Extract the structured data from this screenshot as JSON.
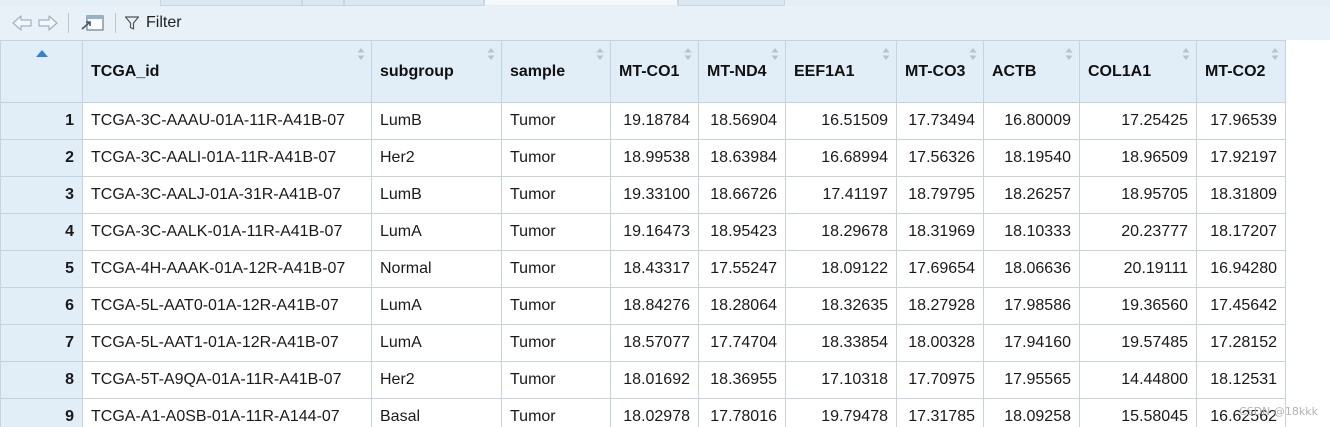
{
  "toolbar": {
    "back_icon": "arrow-left-icon",
    "forward_icon": "arrow-right-icon",
    "popout_icon": "open-in-window-icon",
    "filter_icon": "funnel-icon",
    "filter_label": "Filter"
  },
  "table": {
    "columns": [
      "TCGA_id",
      "subgroup",
      "sample",
      "MT-CO1",
      "MT-ND4",
      "EEF1A1",
      "MT-CO3",
      "ACTB",
      "COL1A1",
      "MT-CO2"
    ],
    "rows": [
      {
        "n": "1",
        "cells": [
          "TCGA-3C-AAAU-01A-11R-A41B-07",
          "LumB",
          "Tumor",
          "19.18784",
          "18.56904",
          "16.51509",
          "17.73494",
          "16.80009",
          "17.25425",
          "17.96539"
        ]
      },
      {
        "n": "2",
        "cells": [
          "TCGA-3C-AALI-01A-11R-A41B-07",
          "Her2",
          "Tumor",
          "18.99538",
          "18.63984",
          "16.68994",
          "17.56326",
          "18.19540",
          "18.96509",
          "17.92197"
        ]
      },
      {
        "n": "3",
        "cells": [
          "TCGA-3C-AALJ-01A-31R-A41B-07",
          "LumB",
          "Tumor",
          "19.33100",
          "18.66726",
          "17.41197",
          "18.79795",
          "18.26257",
          "18.95705",
          "18.31809"
        ]
      },
      {
        "n": "4",
        "cells": [
          "TCGA-3C-AALK-01A-11R-A41B-07",
          "LumA",
          "Tumor",
          "19.16473",
          "18.95423",
          "18.29678",
          "18.31969",
          "18.10333",
          "20.23777",
          "18.17207"
        ]
      },
      {
        "n": "5",
        "cells": [
          "TCGA-4H-AAAK-01A-12R-A41B-07",
          "Normal",
          "Tumor",
          "18.43317",
          "17.55247",
          "18.09122",
          "17.69654",
          "18.06636",
          "20.19111",
          "16.94280"
        ]
      },
      {
        "n": "6",
        "cells": [
          "TCGA-5L-AAT0-01A-12R-A41B-07",
          "LumA",
          "Tumor",
          "18.84276",
          "18.28064",
          "18.32635",
          "18.27928",
          "17.98586",
          "19.36560",
          "17.45642"
        ]
      },
      {
        "n": "7",
        "cells": [
          "TCGA-5L-AAT1-01A-12R-A41B-07",
          "LumA",
          "Tumor",
          "18.57077",
          "17.74704",
          "18.33854",
          "18.00328",
          "17.94160",
          "19.57485",
          "17.28152"
        ]
      },
      {
        "n": "8",
        "cells": [
          "TCGA-5T-A9QA-01A-11R-A41B-07",
          "Her2",
          "Tumor",
          "18.01692",
          "18.36955",
          "17.10318",
          "17.70975",
          "17.95565",
          "14.44800",
          "18.12531"
        ]
      },
      {
        "n": "9",
        "cells": [
          "TCGA-A1-A0SB-01A-11R-A144-07",
          "Basal",
          "Tumor",
          "18.02978",
          "17.78016",
          "19.79478",
          "17.31785",
          "18.09258",
          "15.58045",
          "16.62562"
        ]
      }
    ]
  },
  "watermark": "CSDN @18kkk",
  "colors": {
    "header_bg": "#e1edf7",
    "toolbar_bg": "#e8f1f8",
    "border": "#c5d3df",
    "sort_active": "#2f83d8"
  }
}
